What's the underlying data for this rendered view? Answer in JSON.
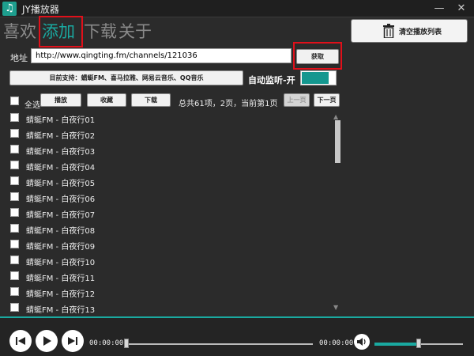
{
  "window": {
    "title": "JY播放器",
    "minimize_glyph": "—",
    "close_glyph": "✕"
  },
  "nav": {
    "tabs": [
      {
        "label": "喜欢"
      },
      {
        "label": "添加",
        "active": true
      },
      {
        "label": "下载"
      },
      {
        "label": "关于"
      }
    ]
  },
  "clear_button": {
    "label": "清空播放列表",
    "icon": "trash-icon"
  },
  "address": {
    "label": "地址",
    "value": "http://www.qingting.fm/channels/121036",
    "fetch_label": "获取"
  },
  "support_label": "目前支持：蜻蜓FM、喜马拉雅、网易云音乐、QQ音乐",
  "monitor": {
    "label": "自动监听-开",
    "on": true
  },
  "toolbar": {
    "select_all": "全选",
    "play": "播放",
    "favorite": "收藏",
    "download": "下载",
    "page_info": "总共61项，2页，当前第1页",
    "prev": "上一页",
    "next": "下一页"
  },
  "tracks": [
    "蜻蜓FM - 白夜行01",
    "蜻蜓FM - 白夜行02",
    "蜻蜓FM - 白夜行03",
    "蜻蜓FM - 白夜行04",
    "蜻蜓FM - 白夜行05",
    "蜻蜓FM - 白夜行06",
    "蜻蜓FM - 白夜行07",
    "蜻蜓FM - 白夜行08",
    "蜻蜓FM - 白夜行09",
    "蜻蜓FM - 白夜行10",
    "蜻蜓FM - 白夜行11",
    "蜻蜓FM - 白夜行12",
    "蜻蜓FM - 白夜行13"
  ],
  "player": {
    "current_time": "00:00:00",
    "total_time": "00:00:00",
    "progress_fraction": 0.0,
    "volume_fraction": 0.5
  },
  "colors": {
    "accent": "#1aa9a0",
    "highlight": "#e0101a",
    "background": "#2b2b2b"
  }
}
